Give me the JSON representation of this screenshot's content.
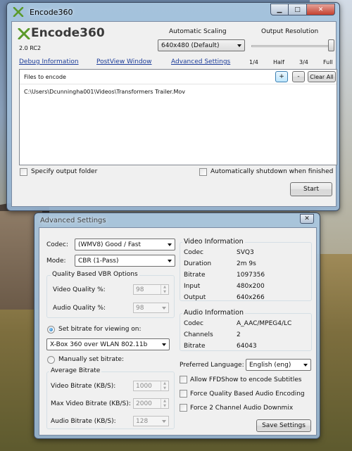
{
  "main_window": {
    "title": "Encode360",
    "logo_text": "Encode360",
    "version": "2.0 RC2",
    "auto_scaling_label": "Automatic Scaling",
    "auto_scaling_value": "640x480 (Default)",
    "output_resolution_label": "Output Resolution",
    "resolution_ticks": [
      "1/4",
      "Half",
      "3/4",
      "Full"
    ],
    "resolution_level": 1.0,
    "links": {
      "debug": "Debug Information",
      "postview": "PostView Window",
      "advanced": "Advanced Settings"
    },
    "files_header": "Files to encode",
    "add_label": "+",
    "remove_label": "-",
    "clear_all_label": "Clear All",
    "files": [
      "C:\\Users\\Dcunningha001\\Videos\\Transformers Trailer.Mov"
    ],
    "specify_output_label": "Specify output folder",
    "auto_shutdown_label": "Automatically shutdown when finished",
    "start_label": "Start"
  },
  "advanced_window": {
    "title": "Advanced Settings",
    "codec_label": "Codec:",
    "codec_value": "(WMV8) Good / Fast",
    "mode_label": "Mode:",
    "mode_value": "CBR (1-Pass)",
    "vbr_group_title": "Quality Based VBR Options",
    "video_quality_label": "Video Quality %:",
    "video_quality_value": "98",
    "audio_quality_label": "Audio Quality %:",
    "audio_quality_value": "98",
    "set_bitrate_label": "Set bitrate for viewing on:",
    "device_value": "X-Box 360 over WLAN 802.11b",
    "manual_bitrate_label": "Manually set bitrate:",
    "avg_group_title": "Average Bitrate",
    "video_bitrate_label": "Video Bitrate (KB/S):",
    "video_bitrate_value": "1000",
    "max_video_bitrate_label": "Max Video Bitrate (KB/S):",
    "max_video_bitrate_value": "2000",
    "audio_bitrate_label": "Audio Bitrate (KB/S):",
    "audio_bitrate_value": "128",
    "video_info": {
      "title": "Video Information",
      "rows": [
        {
          "key": "Codec",
          "value": "SVQ3"
        },
        {
          "key": "Duration",
          "value": "2m 9s"
        },
        {
          "key": "Bitrate",
          "value": "1097356"
        },
        {
          "key": "Input",
          "value": "480x200"
        },
        {
          "key": "Output",
          "value": "640x266"
        }
      ]
    },
    "audio_info": {
      "title": "Audio Information",
      "rows": [
        {
          "key": "Codec",
          "value": "A_AAC/MPEG4/LC"
        },
        {
          "key": "Channels",
          "value": "2"
        },
        {
          "key": "Bitrate",
          "value": "64043"
        }
      ]
    },
    "preferred_language_label": "Preferred Language:",
    "preferred_language_value": "English (eng)",
    "ffdshow_label": "Allow FFDShow to encode Subtitles",
    "force_quality_label": "Force Quality Based Audio Encoding",
    "force_2ch_label": "Force 2 Channel Audio Downmix",
    "save_label": "Save Settings"
  },
  "colors": {
    "link": "#1c3c99",
    "accent": "#3c7fb1",
    "logo_green": "#5a9a2a"
  },
  "icons": [
    "xbox-logo-icon",
    "minimize-icon",
    "maximize-icon",
    "close-icon"
  ]
}
